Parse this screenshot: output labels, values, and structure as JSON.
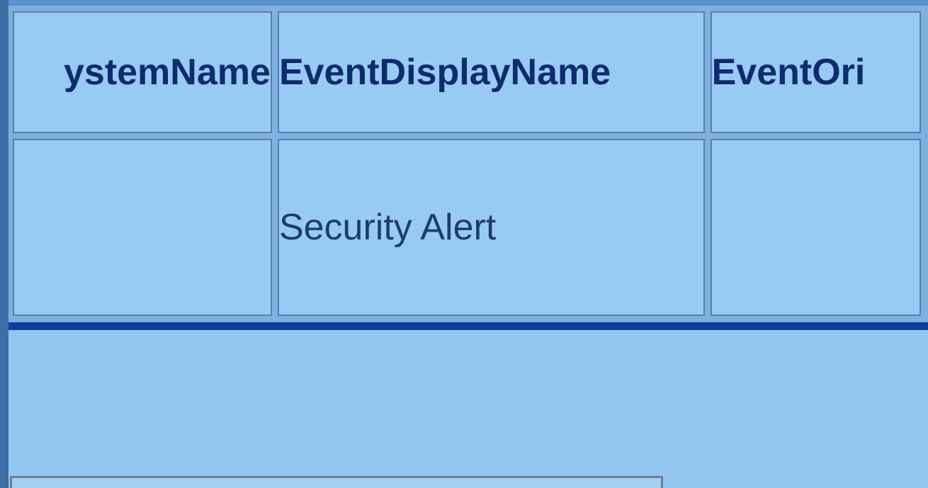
{
  "events_table": {
    "columns": [
      "ystemName",
      "EventDisplayName",
      "EventOri"
    ],
    "rows": [
      [
        "",
        "Security Alert",
        ""
      ]
    ]
  },
  "colors": {
    "background": "#93c6f0",
    "header_text": "#0e2b6e",
    "cell_text": "#1d3c6e",
    "divider": "#0a3f9e",
    "frame": "#3d6ea6"
  }
}
